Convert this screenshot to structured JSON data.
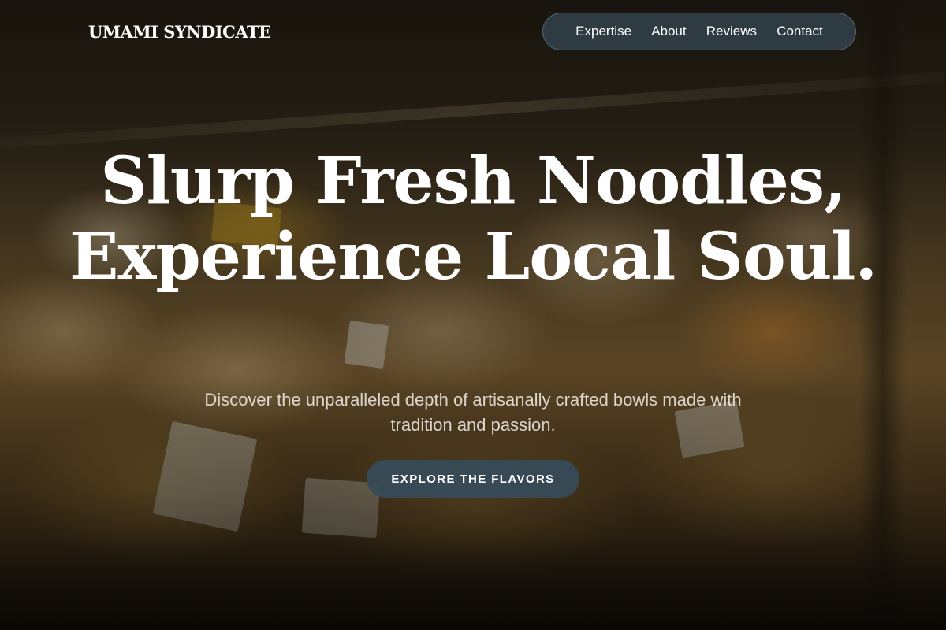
{
  "brand": {
    "logo": "UMAMI SYNDICATE"
  },
  "nav": {
    "items": [
      {
        "label": "Expertise"
      },
      {
        "label": "About"
      },
      {
        "label": "Reviews"
      },
      {
        "label": "Contact"
      }
    ]
  },
  "hero": {
    "headline": "Slurp Fresh Noodles, Experience Local Soul.",
    "subheadline": "Discover the unparalleled depth of artisanally crafted bowls made with tradition and passion.",
    "cta_label": "EXPLORE THE FLAVORS"
  },
  "colors": {
    "nav_background": "#32414b",
    "cta_background": "#374b58",
    "text": "#ffffff"
  }
}
